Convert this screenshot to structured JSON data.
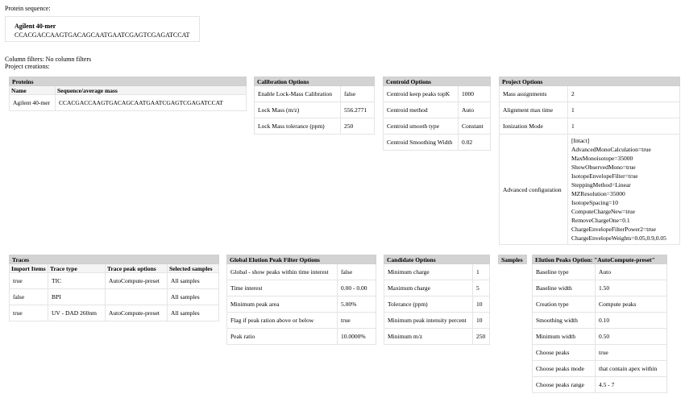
{
  "header": {
    "protein_sequence_label": "Protein sequence:",
    "column_filters": "Column filters: No column filters",
    "project_creations": "Project creations:"
  },
  "sequence_box": {
    "name": "Agilent 40-mer",
    "sequence": "CCACGACCAAGTGACAGCAATGAATCGAGTCGAGATCCAT"
  },
  "proteins": {
    "title": "Proteins",
    "columns": [
      "Name",
      "Sequence/average mass"
    ],
    "rows": [
      [
        "Agilent 40-mer",
        "CCACGACCAAGTGACAGCAATGAATCGAGTCGAGATCCAT"
      ]
    ]
  },
  "calibration": {
    "title": "Calibration Options",
    "rows": [
      [
        "Enable Lock-Mass Calibration",
        "false"
      ],
      [
        "Lock Mass (m/z)",
        "556.2771"
      ],
      [
        "Lock Mass tolerance (ppm)",
        "250"
      ]
    ]
  },
  "centroid": {
    "title": "Centroid Options",
    "rows": [
      [
        "Centroid keep peaks topK",
        "1000"
      ],
      [
        "Centroid method",
        "Auto"
      ],
      [
        "Centroid smooth type",
        "Constant"
      ],
      [
        "Centroid Smoothing Width",
        "0.02"
      ]
    ]
  },
  "project": {
    "title": "Project Options",
    "rows": [
      [
        "Mass assignments",
        "2"
      ],
      [
        "Alignment max time",
        "1"
      ],
      [
        "Ionization Mode",
        "1"
      ]
    ],
    "advanced_label": "Advanced configuration",
    "advanced_lines": [
      "[Intact]",
      "AdvancedMonoCalculation=true",
      "MaxMonoisotope=35000",
      "ShowObservedMono=true",
      "IsotopeEnvelopeFilter=true",
      "SteppingMethod=Linear",
      "MZResolution=35000",
      "IsotopeSpacing=10",
      "ComputeChargeNew=true",
      "RemoveChargeOne=0.1",
      "ChargeEnvelopeFilterPower2=true",
      "ChargeEnvelopeWeights=0.05,0.9,0.05"
    ]
  },
  "traces": {
    "title": "Traces",
    "columns": [
      "Import Items",
      "Trace type",
      "Trace peak options",
      "Selected samples"
    ],
    "rows": [
      [
        "true",
        "TIC",
        "AutoCompute-preset",
        "All samples"
      ],
      [
        "false",
        "BPI",
        "",
        "All samples"
      ],
      [
        "true",
        "UV - DAD 260nm",
        "AutoCompute-preset",
        "All samples"
      ]
    ]
  },
  "global_elution": {
    "title": "Global Elution Peak Filter Options",
    "rows": [
      [
        "Global - show peaks within time interest",
        "false"
      ],
      [
        "Time interest",
        "0.00 - 0.00"
      ],
      [
        "Minimum peak area",
        "5.00%"
      ],
      [
        "Flag if peak ration above or below",
        "true"
      ],
      [
        "Peak ratio",
        "10.0000%"
      ]
    ]
  },
  "candidate": {
    "title": "Candidate Options",
    "rows": [
      [
        "Minimum charge",
        "1"
      ],
      [
        "Maximum charge",
        "5"
      ],
      [
        "Tolerance (ppm)",
        "10"
      ],
      [
        "Minimum peak intensity percent",
        "10"
      ],
      [
        "Minimum m/z",
        "250"
      ]
    ]
  },
  "samples": {
    "title": "Samples"
  },
  "elution_peaks": {
    "title": "Elution Peaks Option: \"AutoCompute-preset\"",
    "rows": [
      [
        "Baseline type",
        "Auto"
      ],
      [
        "Baseline width",
        "1.50"
      ],
      [
        "Creation type",
        "Compute peaks"
      ],
      [
        "Smoothing width",
        "0.10"
      ],
      [
        "Minimum width",
        "0.50"
      ],
      [
        "Choose peaks",
        "true"
      ],
      [
        "Choose peaks mode",
        "that contain apex within"
      ],
      [
        "Choose peaks range",
        "4.5 - 7"
      ]
    ]
  }
}
